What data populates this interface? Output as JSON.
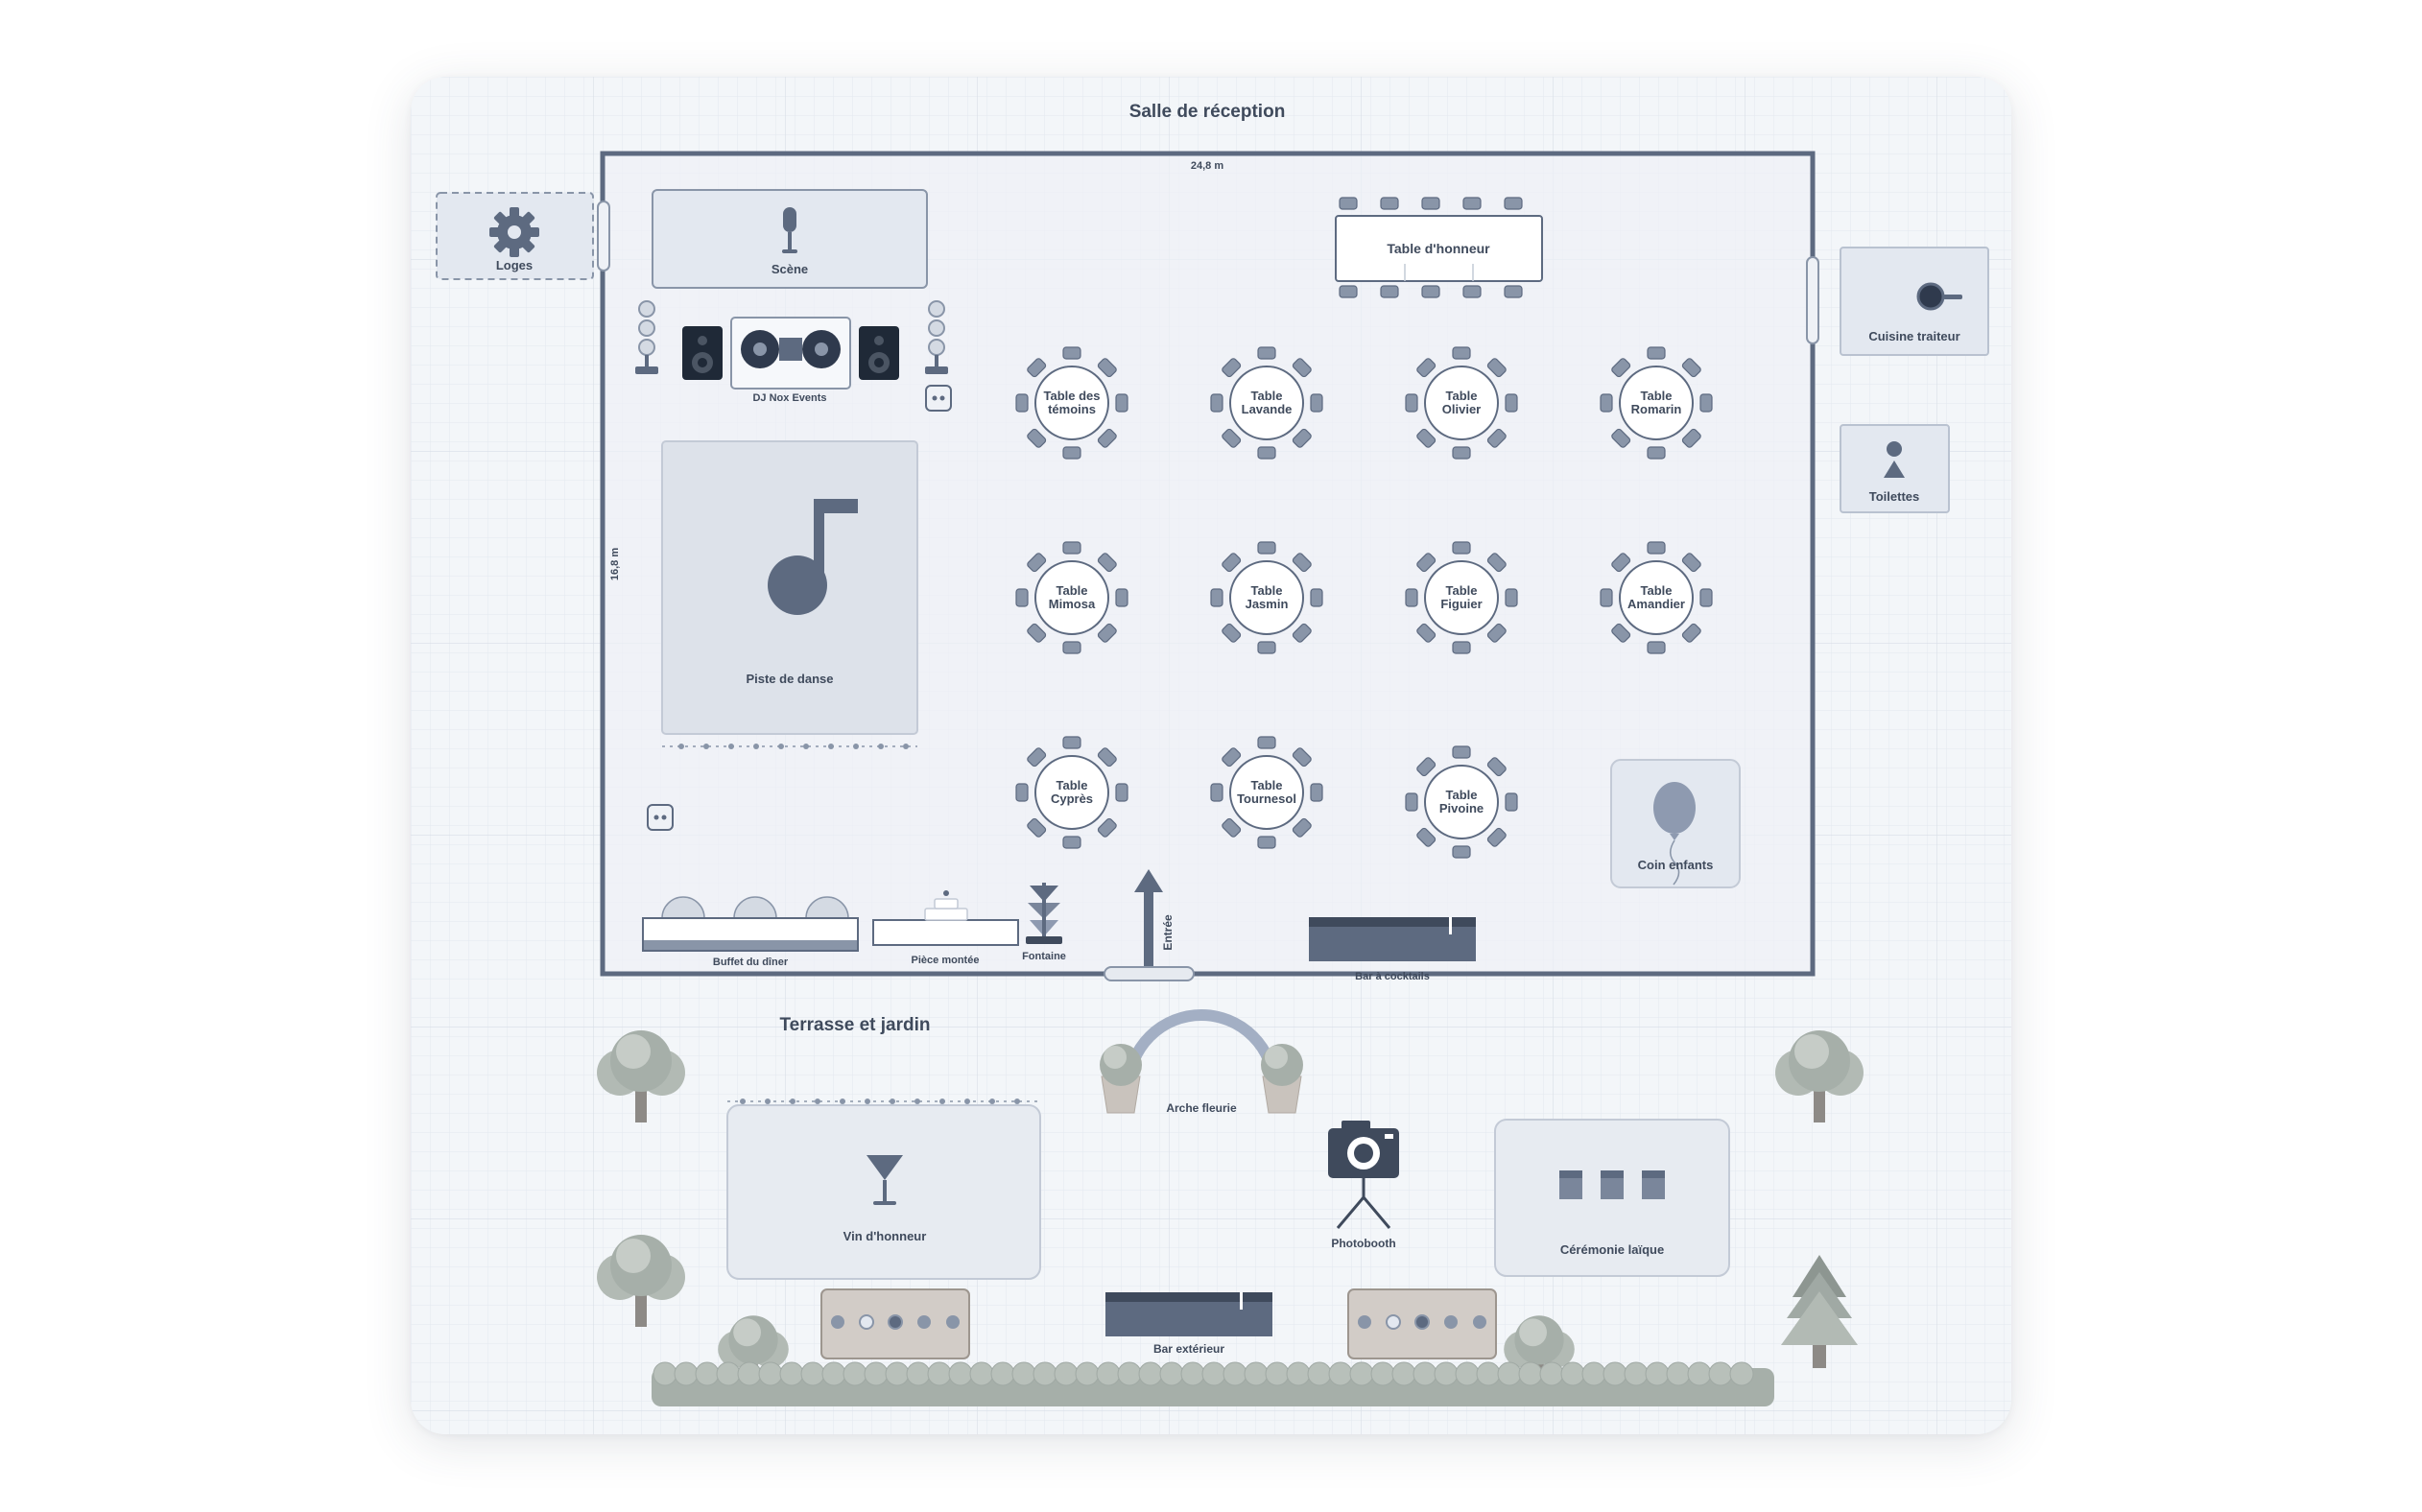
{
  "hall": {
    "title": "Salle de réception",
    "width_label": "24,8 m",
    "height_label": "16,8 m"
  },
  "garden": {
    "title": "Terrasse et jardin"
  },
  "zones": {
    "loges": "Loges",
    "scene": "Scène",
    "dj": "DJ Nox Events",
    "dancefloor": "Piste de danse",
    "honor_table": "Table d'honneur",
    "kitchen": "Cuisine traiteur",
    "toilets": "Toilettes",
    "kids_corner": "Coin enfants",
    "buffet": "Buffet du dîner",
    "cake": "Pièce montée",
    "fountain": "Fontaine",
    "entrance": "Entrée",
    "cocktail_bar": "Bar à cocktails",
    "arch": "Arche fleurie",
    "wine": "Vin d'honneur",
    "photobooth": "Photobooth",
    "ceremony": "Cérémonie laïque",
    "outdoor_bar": "Bar extérieur"
  },
  "tables": [
    {
      "line1": "Table des",
      "line2": "témoins",
      "col": 0,
      "row": 0
    },
    {
      "line1": "Table",
      "line2": "Lavande",
      "col": 1,
      "row": 0
    },
    {
      "line1": "Table",
      "line2": "Olivier",
      "col": 2,
      "row": 0
    },
    {
      "line1": "Table",
      "line2": "Romarin",
      "col": 3,
      "row": 0
    },
    {
      "line1": "Table",
      "line2": "Mimosa",
      "col": 0,
      "row": 1
    },
    {
      "line1": "Table",
      "line2": "Jasmin",
      "col": 1,
      "row": 1
    },
    {
      "line1": "Table",
      "line2": "Figuier",
      "col": 2,
      "row": 1
    },
    {
      "line1": "Table",
      "line2": "Amandier",
      "col": 3,
      "row": 1
    },
    {
      "line1": "Table",
      "line2": "Cyprès",
      "col": 0,
      "row": 2
    },
    {
      "line1": "Table",
      "line2": "Tournesol",
      "col": 1,
      "row": 2
    },
    {
      "line1": "Table",
      "line2": "Pivoine",
      "col": 2,
      "row": 2
    }
  ],
  "colors": {
    "wall": "#5d6a80",
    "accent": "#5d6a80",
    "zone_fill": "#e3e8f0",
    "zone_stroke": "#b9c2d0",
    "foliage": "#aab3ad",
    "trunk": "#8d8a86",
    "bar": "#5d6a80",
    "grid": "#e2e7ee"
  }
}
